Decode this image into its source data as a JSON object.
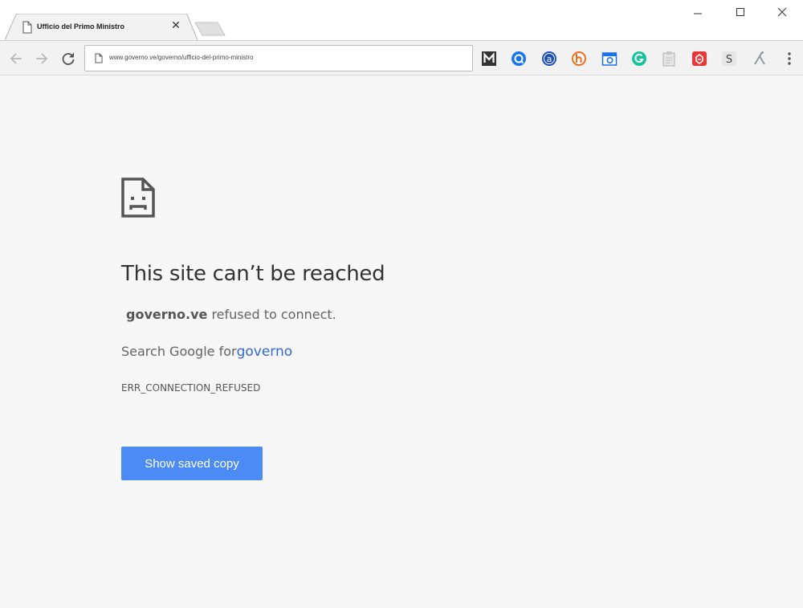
{
  "tab": {
    "title": "Ufficio del Primo Ministro",
    "close_glyph": "✕"
  },
  "window_controls": [
    "minimize-icon",
    "maximize-icon",
    "close-icon"
  ],
  "toolbar": {
    "url": "www.governo.ve/governo/ufficio-del-primo-ministro",
    "nav_icons": [
      "back-icon",
      "forward-icon",
      "reload-icon"
    ]
  },
  "extensions": [
    {
      "name": "m-extension-icon",
      "color": "#333333"
    },
    {
      "name": "q-extension-icon",
      "color": "#1a73e8"
    },
    {
      "name": "a-extension-icon",
      "color": "#1e4fb8"
    },
    {
      "name": "h-extension-icon",
      "color": "#f26b1d"
    },
    {
      "name": "camera-extension-icon",
      "color": "#1a73e8"
    },
    {
      "name": "grammarly-icon",
      "color": "#15c39a"
    },
    {
      "name": "clipboard-extension-icon",
      "color": "#b0b0b0"
    },
    {
      "name": "red-shield-extension-icon",
      "color": "#e53935"
    },
    {
      "name": "s-extension-icon",
      "color": "#666666"
    },
    {
      "name": "branch-extension-icon",
      "color": "#8e9ba3"
    },
    {
      "name": "menu-icon",
      "color": "#555555"
    }
  ],
  "extension_letters": {
    "m": "M",
    "a": "a",
    "h": "h",
    "g": "G",
    "s": "S"
  },
  "error": {
    "heading": "This site can’t be reached",
    "host": "governo.ve",
    "refused_text": "refused to connect.",
    "search_prefix": "Search Google for",
    "search_term": "governo",
    "code": "ERR_CONNECTION_REFUSED",
    "button_label": "Show saved copy"
  },
  "colors": {
    "accent": "#4c8bf5",
    "link": "#3367d6",
    "background": "#f7f7f7"
  }
}
